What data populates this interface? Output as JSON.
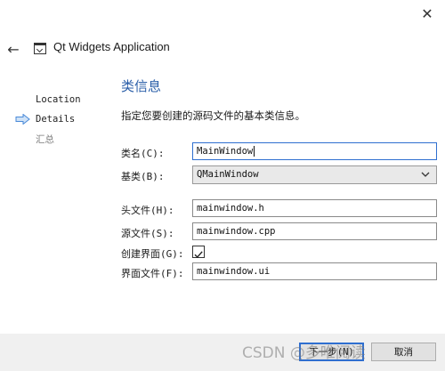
{
  "window": {
    "title": "Qt Widgets Application",
    "close_glyph": "✕",
    "back_glyph": "←"
  },
  "sidebar": {
    "items": [
      {
        "label": "Location",
        "state": "done"
      },
      {
        "label": "Details",
        "state": "current"
      },
      {
        "label": "汇总",
        "state": "pending"
      }
    ],
    "current_indicator_color": "#4a8ad8"
  },
  "main": {
    "title": "类信息",
    "description": "指定您要创建的源码文件的基本类信息。",
    "fields": {
      "class_name": {
        "label": "类名(C):",
        "value": "MainWindow"
      },
      "base_class": {
        "label": "基类(B):",
        "value": "QMainWindow"
      },
      "header_file": {
        "label": "头文件(H):",
        "value": "mainwindow.h"
      },
      "source_file": {
        "label": "源文件(S):",
        "value": "mainwindow.cpp"
      },
      "create_form": {
        "label": "创建界面(G):",
        "checked": true
      },
      "form_file": {
        "label": "界面文件(F):",
        "value": "mainwindow.ui"
      }
    }
  },
  "footer": {
    "next_label": "下一步(N)",
    "cancel_label": "取消"
  },
  "watermark": "CSDN @多唯阅读"
}
